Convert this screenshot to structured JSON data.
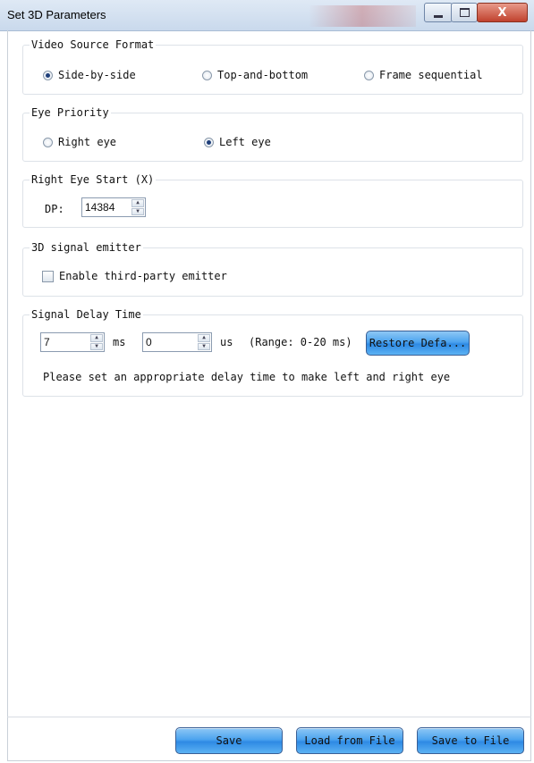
{
  "window": {
    "title": "Set 3D Parameters",
    "close_glyph": "X"
  },
  "video_source": {
    "title": "Video Source Format",
    "options": [
      {
        "label": "Side-by-side",
        "selected": true
      },
      {
        "label": "Top-and-bottom",
        "selected": false
      },
      {
        "label": "Frame sequential",
        "selected": false
      }
    ]
  },
  "eye_priority": {
    "title": "Eye Priority",
    "options": [
      {
        "label": "Right eye",
        "selected": false
      },
      {
        "label": "Left eye",
        "selected": true
      }
    ]
  },
  "right_eye_start": {
    "title": "Right Eye Start (X)",
    "dp_label": "DP:",
    "dp_value": "14384"
  },
  "emitter": {
    "title": "3D signal emitter",
    "checkbox_label": "Enable third-party emitter",
    "checked": false
  },
  "signal_delay": {
    "title": "Signal Delay Time",
    "ms_value": "7",
    "ms_unit": "ms",
    "us_value": "0",
    "us_unit": "us",
    "range_text": "(Range: 0-20 ms)",
    "restore_label": "Restore Defa...",
    "hint": "Please set an appropriate delay time to make left and right eye"
  },
  "footer": {
    "save_label": "Save",
    "load_label": "Load from File",
    "save_to_file_label": "Save to File"
  },
  "colors": {
    "button_blue": "#4da4ef",
    "titlebar": "#c9d9ec",
    "close_red": "#c0422e"
  }
}
